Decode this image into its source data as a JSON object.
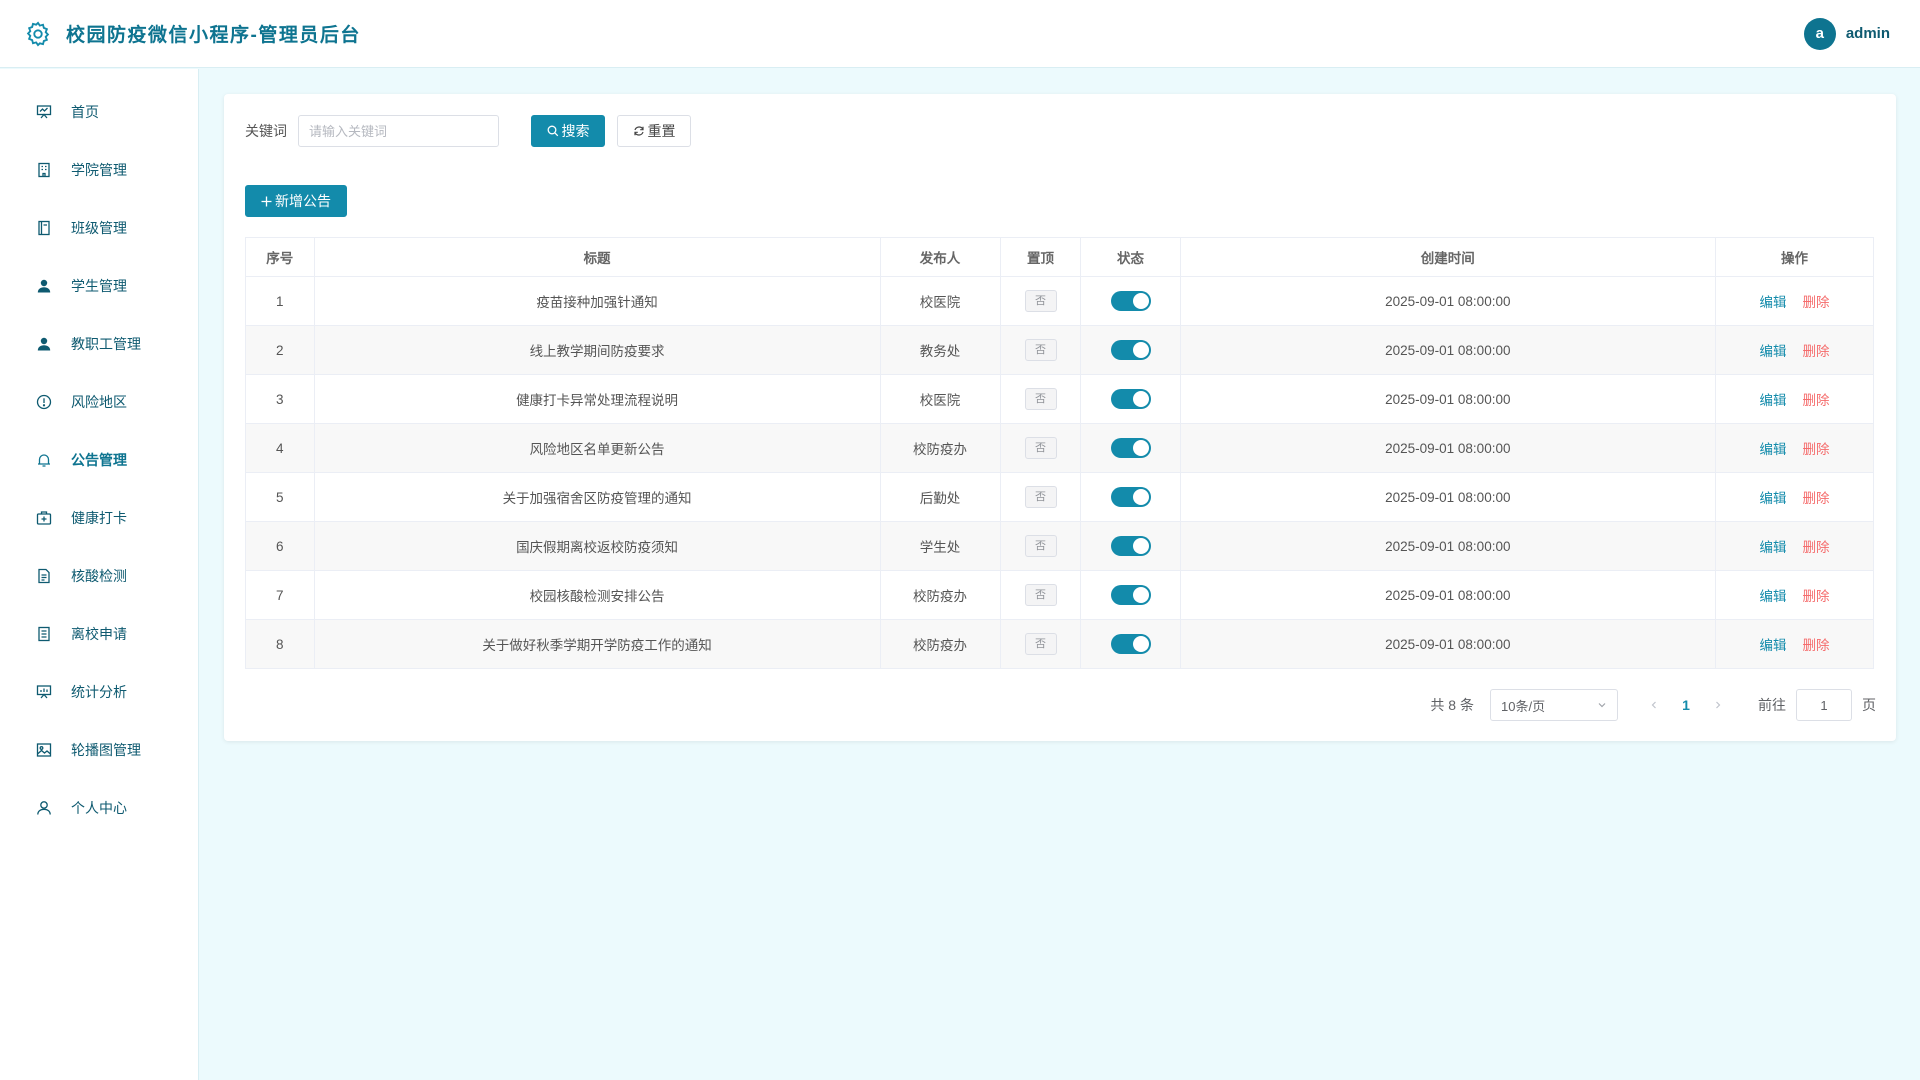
{
  "header": {
    "title": "校园防疫微信小程序-管理员后台",
    "avatar_letter": "a",
    "username": "admin"
  },
  "sidebar": {
    "items": [
      {
        "label": "首页",
        "icon": "presentation-icon"
      },
      {
        "label": "学院管理",
        "icon": "building-icon"
      },
      {
        "label": "班级管理",
        "icon": "notebook-icon"
      },
      {
        "label": "学生管理",
        "icon": "user-filled-icon"
      },
      {
        "label": "教职工管理",
        "icon": "user-filled-icon"
      },
      {
        "label": "风险地区",
        "icon": "warning-circle-icon"
      },
      {
        "label": "公告管理",
        "icon": "bell-icon",
        "active": true
      },
      {
        "label": "健康打卡",
        "icon": "first-aid-kit-icon"
      },
      {
        "label": "核酸检测",
        "icon": "document-icon"
      },
      {
        "label": "离校申请",
        "icon": "tickets-icon"
      },
      {
        "label": "统计分析",
        "icon": "data-board-icon"
      },
      {
        "label": "轮播图管理",
        "icon": "picture-icon"
      },
      {
        "label": "个人中心",
        "icon": "user-icon"
      }
    ]
  },
  "search": {
    "label": "关键词",
    "placeholder": "请输入关键词",
    "value": "",
    "search_btn": "搜索",
    "reset_btn": "重置"
  },
  "add_btn": "新增公告",
  "table": {
    "headers": [
      "序号",
      "标题",
      "发布人",
      "置顶",
      "状态",
      "创建时间",
      "操作"
    ],
    "rows": [
      {
        "no": "1",
        "title": "疫苗接种加强针通知",
        "publisher": "校医院",
        "top": "否",
        "status_on": true,
        "created": "2025-09-01 08:00:00"
      },
      {
        "no": "2",
        "title": "线上教学期间防疫要求",
        "publisher": "教务处",
        "top": "否",
        "status_on": true,
        "created": "2025-09-01 08:00:00"
      },
      {
        "no": "3",
        "title": "健康打卡异常处理流程说明",
        "publisher": "校医院",
        "top": "否",
        "status_on": true,
        "created": "2025-09-01 08:00:00"
      },
      {
        "no": "4",
        "title": "风险地区名单更新公告",
        "publisher": "校防疫办",
        "top": "否",
        "status_on": true,
        "created": "2025-09-01 08:00:00"
      },
      {
        "no": "5",
        "title": "关于加强宿舍区防疫管理的通知",
        "publisher": "后勤处",
        "top": "否",
        "status_on": true,
        "created": "2025-09-01 08:00:00"
      },
      {
        "no": "6",
        "title": "国庆假期离校返校防疫须知",
        "publisher": "学生处",
        "top": "否",
        "status_on": true,
        "created": "2025-09-01 08:00:00"
      },
      {
        "no": "7",
        "title": "校园核酸检测安排公告",
        "publisher": "校防疫办",
        "top": "否",
        "status_on": true,
        "created": "2025-09-01 08:00:00"
      },
      {
        "no": "8",
        "title": "关于做好秋季学期开学防疫工作的通知",
        "publisher": "校防疫办",
        "top": "否",
        "status_on": true,
        "created": "2025-09-01 08:00:00"
      }
    ],
    "edit_label": "编辑",
    "delete_label": "删除"
  },
  "pagination": {
    "total_text": "共 8 条",
    "page_size": "10条/页",
    "current_page": "1",
    "goto_label": "前往",
    "goto_value": "1",
    "page_suffix": "页"
  },
  "colors": {
    "primary": "#138bab",
    "brand_text": "#0e7490",
    "danger": "#f56c6c",
    "page_bg": "#ecfafd"
  }
}
